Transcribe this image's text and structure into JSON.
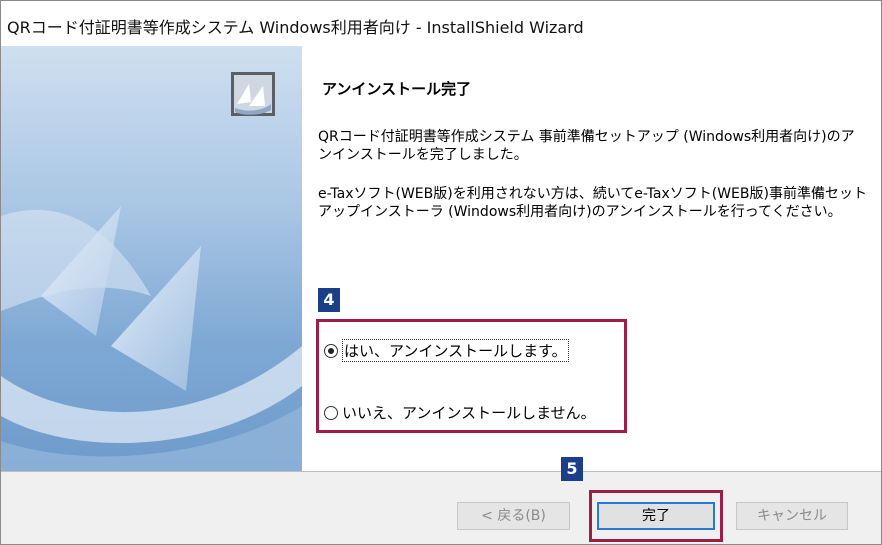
{
  "window": {
    "title": "QRコード付証明書等作成システム Windows利用者向け - InstallShield Wizard"
  },
  "content": {
    "heading": "アンインストール完了",
    "message1": "QRコード付証明書等作成システム 事前準備セットアップ (Windows利用者向け)のアンインストールを完了しました。",
    "message2": "e-Taxソフト(WEB版)を利用されない方は、続いてe-Taxソフト(WEB版)事前準備セットアップインストーラ (Windows利用者向け)のアンインストールを行ってください。"
  },
  "options": [
    {
      "label": "はい、アンインストールします。",
      "selected": true
    },
    {
      "label": "いいえ、アンインストールしません。",
      "selected": false
    }
  ],
  "annotations": {
    "step4": "4",
    "step5": "5",
    "highlight_color": "#9c1f4a",
    "badge_color": "#1a3e88"
  },
  "buttons": {
    "back": "< 戻る(B)",
    "finish": "完了",
    "cancel": "キャンセル"
  },
  "icons": {
    "banner_logo": "installshield-logo-icon",
    "banner_art": "installshield-banner-art"
  }
}
